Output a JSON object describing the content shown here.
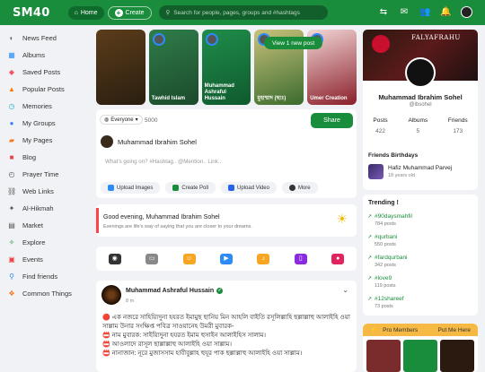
{
  "topbar": {
    "logo": "SM40",
    "home_label": "Home",
    "create_label": "Create",
    "search_placeholder": "Search for people, pages, groups and #hashtags"
  },
  "sidebar": {
    "items": [
      {
        "label": "News Feed",
        "icon": "news-feed-icon",
        "color": "#5b6a7a"
      },
      {
        "label": "Albums",
        "icon": "albums-icon",
        "color": "#2b8cf6"
      },
      {
        "label": "Saved Posts",
        "icon": "saved-posts-icon",
        "color": "#f0566a"
      },
      {
        "label": "Popular Posts",
        "icon": "popular-posts-icon",
        "color": "#f57c00"
      },
      {
        "label": "Memories",
        "icon": "memories-icon",
        "color": "#2bb0c8"
      },
      {
        "label": "My Groups",
        "icon": "groups-icon",
        "color": "#3b82f6"
      },
      {
        "label": "My Pages",
        "icon": "pages-icon",
        "color": "#f97316"
      },
      {
        "label": "Blog",
        "icon": "blog-icon",
        "color": "#ef4444"
      },
      {
        "label": "Prayer Time",
        "icon": "prayer-time-icon",
        "color": "#555"
      },
      {
        "label": "Web Links",
        "icon": "web-links-icon",
        "color": "#555"
      },
      {
        "label": "Al-Hikmah",
        "icon": "al-hikmah-icon",
        "color": "#555"
      },
      {
        "label": "Market",
        "icon": "market-icon",
        "color": "#555"
      },
      {
        "label": "Explore",
        "icon": "explore-icon",
        "color": "#1a8d3c"
      },
      {
        "label": "Events",
        "icon": "events-icon",
        "color": "#ef4444"
      },
      {
        "label": "Find friends",
        "icon": "find-friends-icon",
        "color": "#2b8cf6"
      },
      {
        "label": "Common Things",
        "icon": "common-things-icon",
        "color": "#f97316"
      }
    ]
  },
  "stories": [
    {
      "label": "",
      "bg": "#2a1e10"
    },
    {
      "label": "Tawhid Islam",
      "bg": "#1b4a2b"
    },
    {
      "label": "Muhammad Ashraful Hussain",
      "bg": "#0f5a2e"
    },
    {
      "label": "মুহাম্মাদ (ছাঃ)",
      "bg": "#3a6b2e"
    },
    {
      "label": "Umer Creation",
      "bg": "#8a1f2a"
    }
  ],
  "new_post_banner": "View 1 new post",
  "composer": {
    "privacy": "Everyone",
    "char_count": "5000",
    "share_label": "Share",
    "user_name": "Muhammad Ibrahim Sohel",
    "placeholder": "What's going on? #Hashtag.. @Mention.. Link..",
    "buttons": [
      {
        "label": "Upload Images",
        "color": "#2b8cf6"
      },
      {
        "label": "Create Poll",
        "color": "#1a8d3c"
      },
      {
        "label": "Upload Video",
        "color": "#2563eb"
      },
      {
        "label": "More",
        "color": "#333"
      }
    ]
  },
  "greeting": {
    "title": "Good evening, Muhammad Ibrahim Sohel",
    "subtitle": "Evenings are life's way of saying that you are closer to your dreams."
  },
  "post_types": [
    {
      "icon": "camera-icon",
      "color": "#333"
    },
    {
      "icon": "gif-icon",
      "color": "#888"
    },
    {
      "icon": "smile-icon",
      "color": "#f5a623"
    },
    {
      "icon": "video-icon",
      "color": "#2b8cf6"
    },
    {
      "icon": "music-icon",
      "color": "#f5a623"
    },
    {
      "icon": "file-icon",
      "color": "#8a2be2"
    },
    {
      "icon": "record-icon",
      "color": "#e0245e"
    }
  ],
  "post": {
    "author": "Muhammad Ashraful Hussain",
    "time": "8 m",
    "lines": [
      "🔴 এক নজরে সাহিয়্যিদুনা হযরত ইমামুছ ছানিয় মিন আহলি বাইতি রসূলিল্লাহি ছল্লাল্লাহু আলাইহি ওয়া সাল্লাম উনার সংক্ষিপ্ত পবিত্র সাওয়ানেহ উমরী মুবারক-",
      "📛 নাম মুবারক: সাইয়্যিদুনা হযরত ইমাম হুসাইন আলাইহিস সালাম।",
      "📛 আওলাদে রাসূল ছাল্লাল্লাহু আলাইহি ওয়া সাল্লাম।",
      "📛 নানাজান: নূরে মুজাসসাম হাবীবুল্লাহ হুযূর পাক ছল্লাল্লাহু আলাইহি ওয়া সাল্লাম।"
    ]
  },
  "profile": {
    "cover_title": "FALYAFRAHU",
    "name": "Muhammad Ibrahim Sohel",
    "handle": "@ibsohel",
    "stats": [
      {
        "label": "Posts",
        "value": "422"
      },
      {
        "label": "Albums",
        "value": "5"
      },
      {
        "label": "Friends",
        "value": "173"
      }
    ],
    "birthdays_title": "Friends Birthdays",
    "birthday_name": "Hafiz Muhammad Parvej",
    "birthday_age": "18 years old"
  },
  "trending": {
    "title": "Trending !",
    "items": [
      {
        "tag": "#90daysmahfil",
        "count": "784 posts"
      },
      {
        "tag": "#qurbani",
        "count": "550 posts"
      },
      {
        "tag": "#fardqurbani",
        "count": "342 posts"
      },
      {
        "tag": "#love9",
        "count": "119 posts"
      },
      {
        "tag": "#12shareef",
        "count": "73 posts"
      }
    ]
  },
  "pro_members": {
    "title": "Pro Members",
    "action": "Put Me Here"
  }
}
